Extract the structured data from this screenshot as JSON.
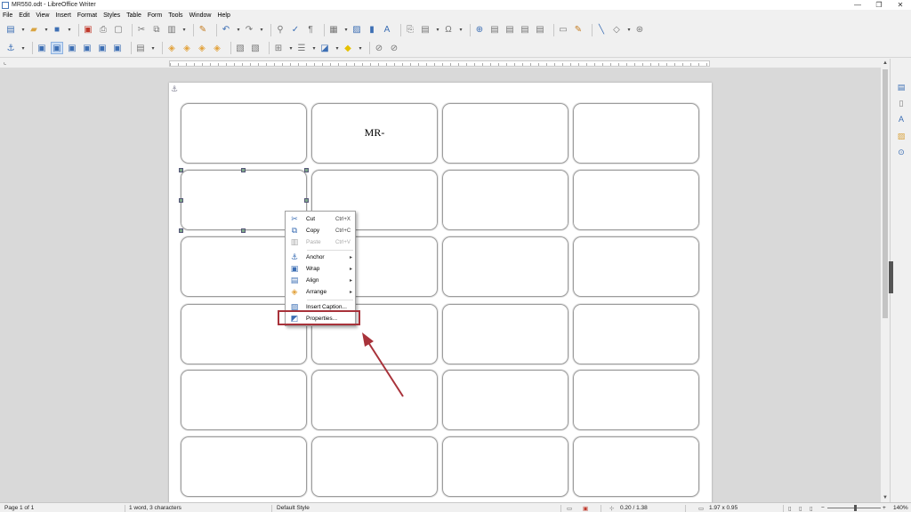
{
  "window": {
    "title": "MR550.odt - LibreOffice Writer",
    "minimize": "—",
    "restore": "❐",
    "close": "✕"
  },
  "menu": [
    "File",
    "Edit",
    "View",
    "Insert",
    "Format",
    "Styles",
    "Table",
    "Form",
    "Tools",
    "Window",
    "Help"
  ],
  "toolbar1_icons": [
    "new-icon",
    "open-icon",
    "save-icon",
    "export-pdf-icon",
    "print-icon",
    "print-preview-icon",
    "cut-icon",
    "copy-icon",
    "paste-icon",
    "clone-formatting-icon",
    "undo-icon",
    "redo-icon",
    "find-replace-icon",
    "spelling-icon",
    "formatting-marks-icon",
    "insert-table-icon",
    "insert-image-icon",
    "insert-chart-icon",
    "insert-textbox-icon",
    "page-break-icon",
    "field-icon",
    "special-character-icon",
    "hyperlink-icon",
    "footnote-icon",
    "endnote-icon",
    "bookmark-icon",
    "cross-reference-icon",
    "comment-icon",
    "track-changes-icon",
    "line-icon",
    "shapes-icon",
    "draw-functions-icon"
  ],
  "toolbar2_icons": [
    "anchor-icon",
    "wrap-off-icon",
    "wrap-parallel-icon",
    "wrap-optimal-icon",
    "wrap-before-icon",
    "wrap-after-icon",
    "wrap-through-icon",
    "align-objects-icon",
    "bring-to-front-icon",
    "forward-one-icon",
    "backward-one-icon",
    "send-to-back-icon",
    "to-foreground-icon",
    "to-background-icon",
    "borders-icon",
    "border-style-icon",
    "border-color-icon",
    "area-color-icon",
    "link-frames-icon",
    "unlink-frames-icon"
  ],
  "document": {
    "label_text": "MR-"
  },
  "context_menu": {
    "items": [
      {
        "label": "Cut",
        "shortcut": "Ctrl+X",
        "icon": "cut-icon",
        "submenu": false,
        "enabled": true
      },
      {
        "label": "Copy",
        "shortcut": "Ctrl+C",
        "icon": "copy-icon",
        "submenu": false,
        "enabled": true
      },
      {
        "label": "Paste",
        "shortcut": "Ctrl+V",
        "icon": "paste-icon",
        "submenu": false,
        "enabled": false
      },
      {
        "label": "Anchor",
        "shortcut": "",
        "icon": "anchor-icon",
        "submenu": true,
        "enabled": true
      },
      {
        "label": "Wrap",
        "shortcut": "",
        "icon": "wrap-icon",
        "submenu": true,
        "enabled": true
      },
      {
        "label": "Align",
        "shortcut": "",
        "icon": "align-icon",
        "submenu": true,
        "enabled": true
      },
      {
        "label": "Arrange",
        "shortcut": "",
        "icon": "arrange-icon",
        "submenu": true,
        "enabled": true
      },
      {
        "label": "Insert Caption...",
        "shortcut": "",
        "icon": "insert-caption-icon",
        "submenu": false,
        "enabled": true
      },
      {
        "label": "Properties...",
        "shortcut": "",
        "icon": "properties-icon",
        "submenu": false,
        "enabled": true
      }
    ]
  },
  "annotation": {
    "highlight_color": "#a8323a",
    "arrow_color": "#a8323a"
  },
  "status": {
    "page": "Page 1 of 1",
    "words": "1 word, 3 characters",
    "style": "Default Style",
    "position": "0.20 / 1.38",
    "size": "1.97 x 0.95",
    "zoom": "140%"
  }
}
